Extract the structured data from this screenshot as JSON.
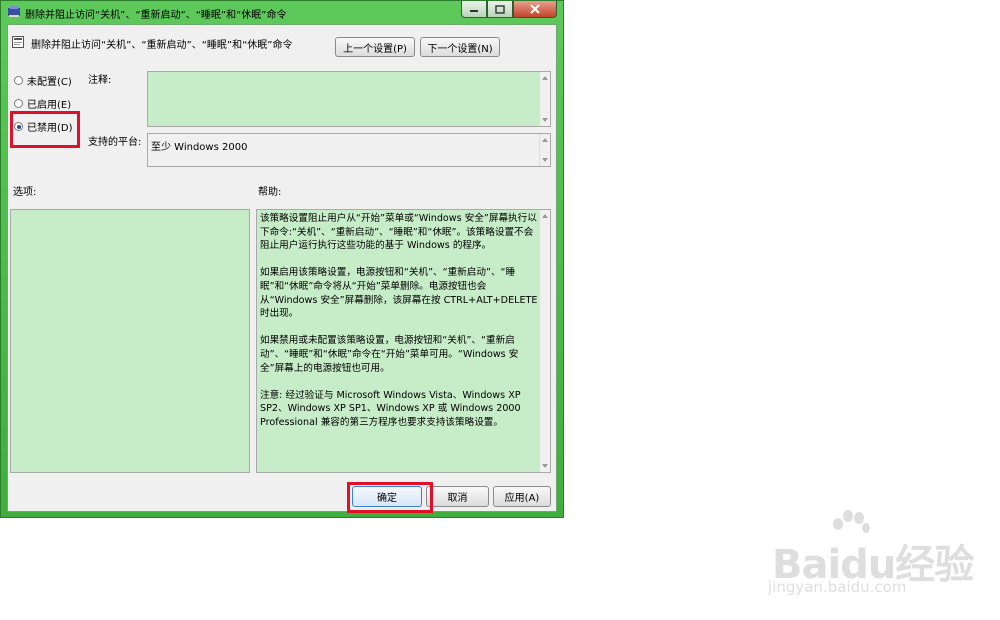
{
  "window": {
    "title": "删除并阻止访问“关机”、“重新启动”、“睡眠”和“休眠”命令"
  },
  "header": {
    "policy_title": "删除并阻止访问“关机”、“重新启动”、“睡眠”和“休眠”命令",
    "prev_label": "上一个设置(P)",
    "next_label": "下一个设置(N)"
  },
  "state": {
    "options": [
      {
        "label": "未配置(C)",
        "selected": false
      },
      {
        "label": "已启用(E)",
        "selected": false
      },
      {
        "label": "已禁用(D)",
        "selected": true
      }
    ]
  },
  "labels": {
    "comment": "注释:",
    "platform": "支持的平台:",
    "options": "选项:",
    "help": "帮助:"
  },
  "platform_value": "至少 Windows 2000",
  "help_paragraphs": [
    "该策略设置阻止用户从“开始”菜单或“Windows 安全”屏幕执行以下命令:“关机”、“重新启动”、“睡眠”和“休眠”。该策略设置不会阻止用户运行执行这些功能的基于 Windows 的程序。",
    "如果启用该策略设置，电源按钮和“关机”、“重新启动”、“睡眠”和“休眠”命令将从“开始”菜单删除。电源按钮也会从“Windows 安全”屏幕删除，该屏幕在按 CTRL+ALT+DELETE 时出现。",
    "如果禁用或未配置该策略设置，电源按钮和“关机”、“重新启动”、“睡眠”和“休眠”命令在“开始”菜单可用。“Windows 安全”屏幕上的电源按钮也可用。",
    "注意: 经过验证与 Microsoft Windows Vista、Windows XP SP2、Windows XP SP1、Windows XP 或 Windows 2000 Professional 兼容的第三方程序也要求支持该策略设置。"
  ],
  "footer": {
    "ok_label": "确定",
    "cancel_label": "取消",
    "apply_label": "应用(A)"
  },
  "watermark": {
    "main": "Baidu经验",
    "sub": "jingyan.baidu.com"
  },
  "colors": {
    "frame": "#4dbb4b",
    "field_bg": "#c7ecc8",
    "highlight": "#e0102a"
  }
}
